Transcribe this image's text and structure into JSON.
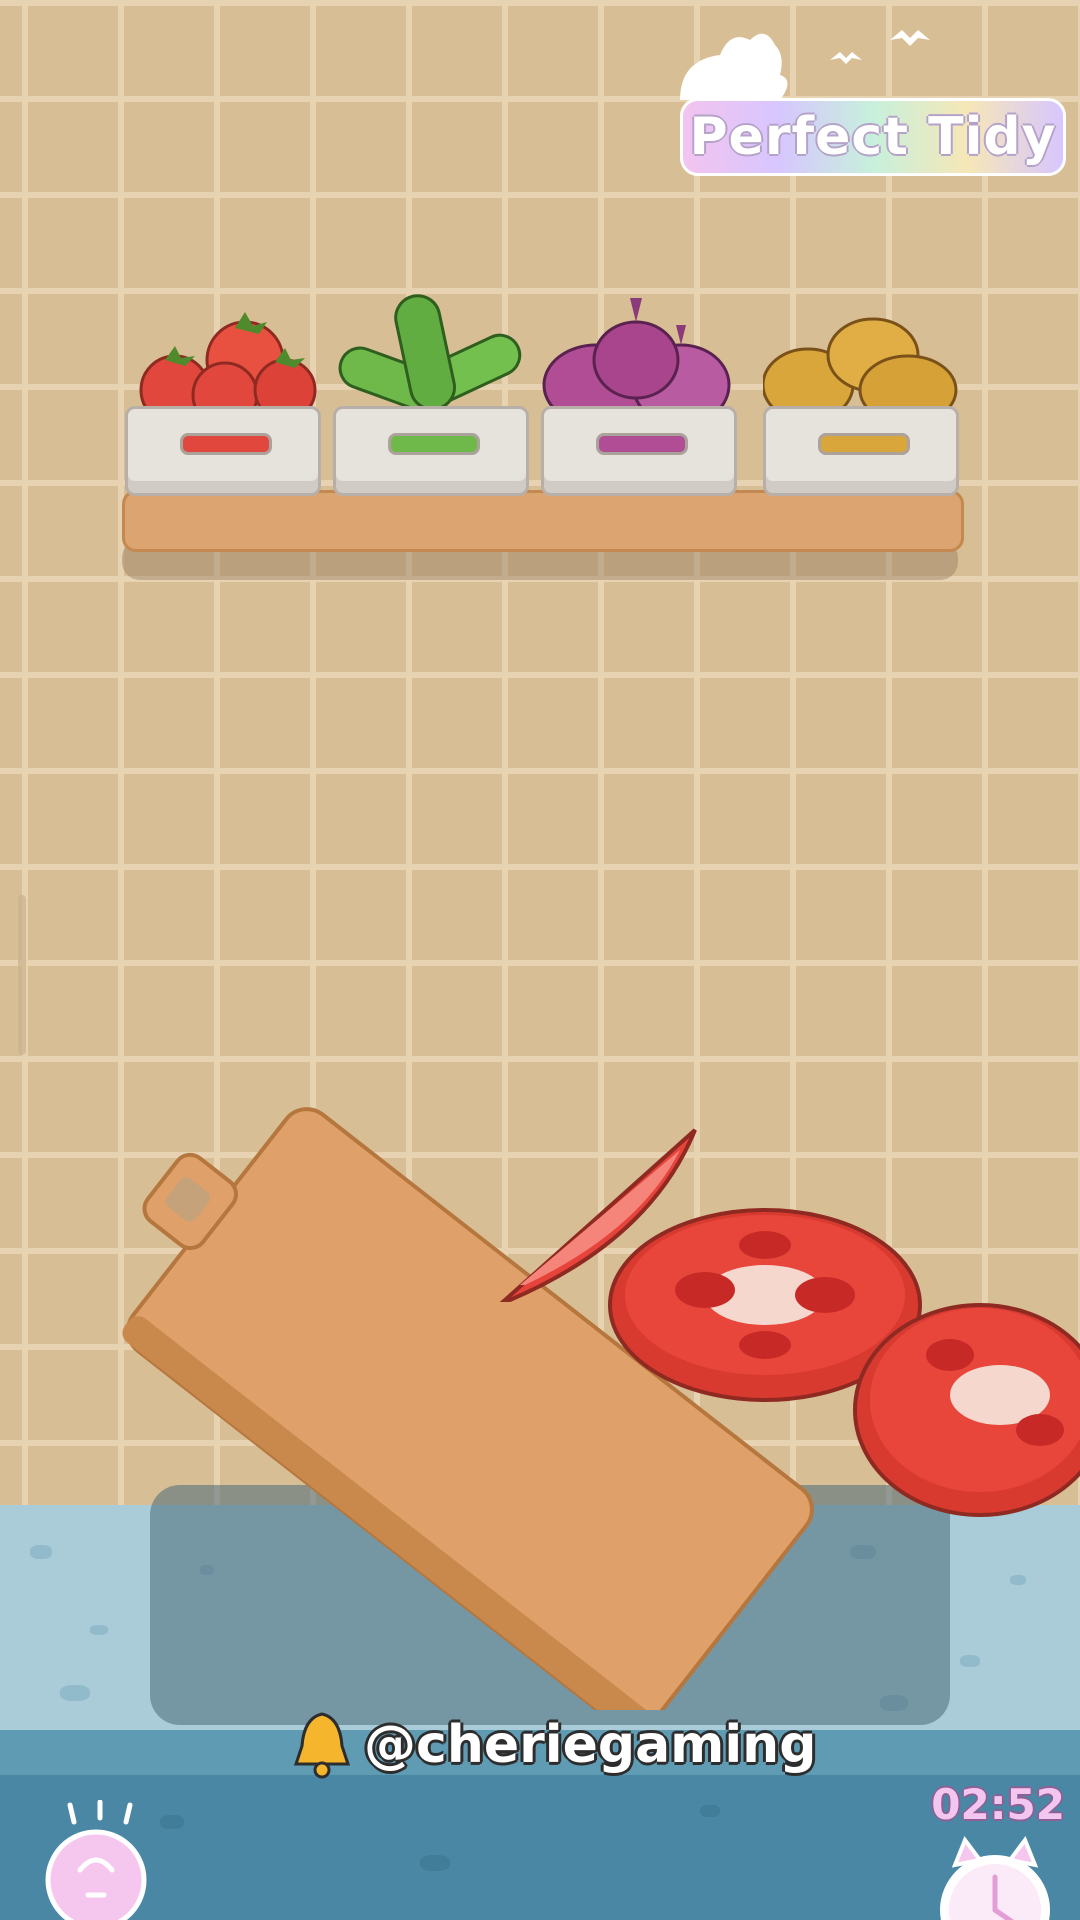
{
  "game": {
    "title": "Perfect Tidy",
    "handle": "@cheriegaming",
    "timer": "02:52"
  },
  "shelf": {
    "bins": [
      {
        "name": "tomatoes",
        "color": "#e2473d"
      },
      {
        "name": "cucumbers",
        "color": "#6eb94a"
      },
      {
        "name": "red-onions",
        "color": "#b04d94"
      },
      {
        "name": "potatoes",
        "color": "#d9a63b"
      }
    ]
  },
  "icons": {
    "hint": "lightbulb-icon",
    "clock": "clock-icon",
    "bell": "bell-icon"
  },
  "colors": {
    "wall": "#d8be95",
    "counter": "#a9ccd8",
    "board": "#dfa169",
    "tomato": "#e8433a"
  }
}
